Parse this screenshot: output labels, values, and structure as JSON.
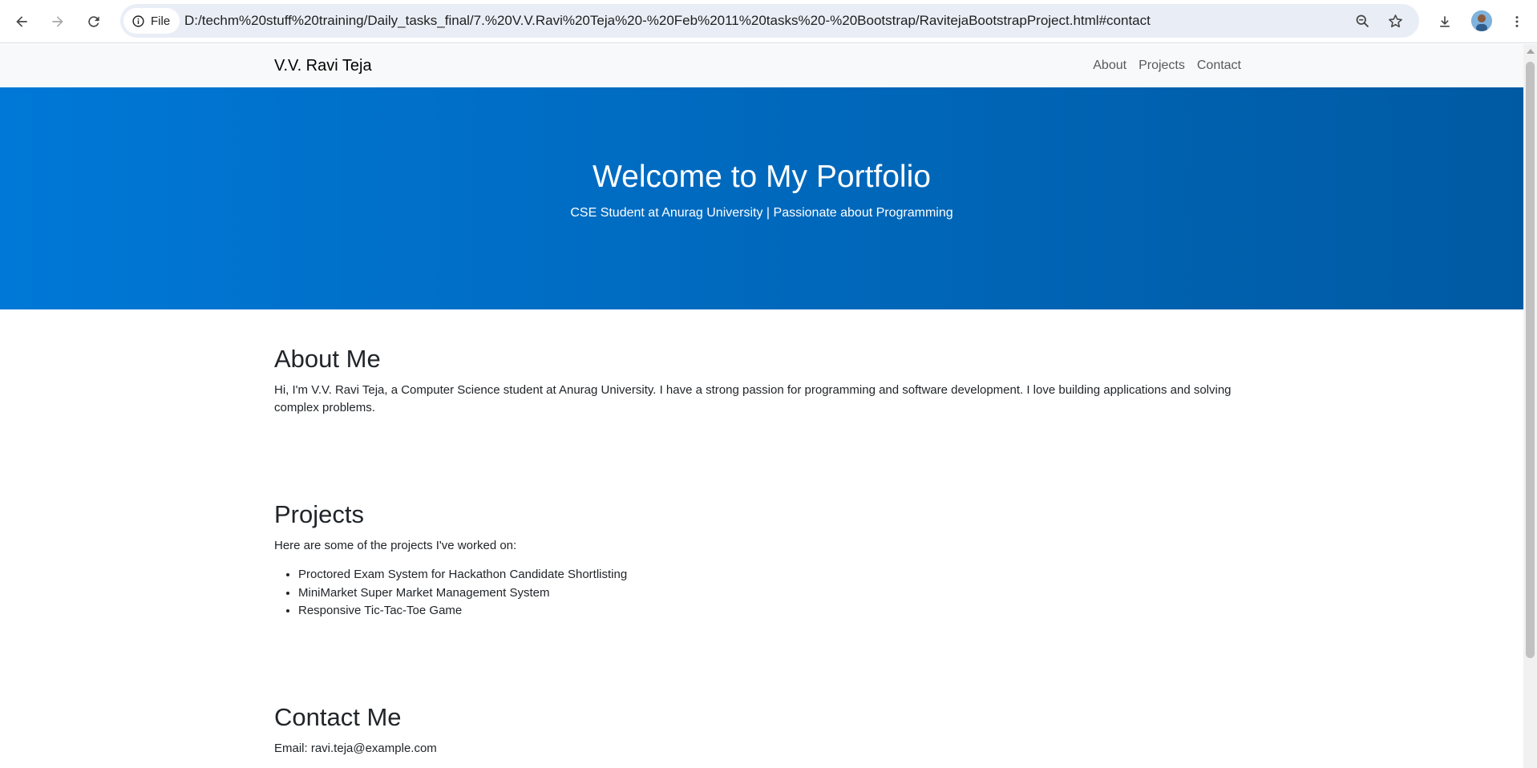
{
  "browser": {
    "site_chip_label": "File",
    "url": "D:/techm%20stuff%20training/Daily_tasks_final/7.%20V.V.Ravi%20Teja%20-%20Feb%2011%20tasks%20-%20Bootstrap/RavitejaBootstrapProject.html#contact",
    "icons": [
      "back-icon",
      "forward-icon",
      "reload-icon",
      "info-icon",
      "zoom-icon",
      "star-icon",
      "download-icon",
      "avatar",
      "more-icon"
    ]
  },
  "navbar": {
    "brand": "V.V. Ravi Teja",
    "links": [
      "About",
      "Projects",
      "Contact"
    ]
  },
  "hero": {
    "title": "Welcome to My Portfolio",
    "subtitle": "CSE Student at Anurag University | Passionate about Programming",
    "gradient_start": "#0078d7",
    "gradient_end": "#005aa3"
  },
  "about": {
    "heading": "About Me",
    "text": "Hi, I'm V.V. Ravi Teja, a Computer Science student at Anurag University. I have a strong passion for programming and software development. I love building applications and solving complex problems."
  },
  "projects": {
    "heading": "Projects",
    "intro": "Here are some of the projects I've worked on:",
    "items": [
      "Proctored Exam System for Hackathon Candidate Shortlisting",
      "MiniMarket Super Market Management System",
      "Responsive Tic-Tac-Toe Game"
    ]
  },
  "contact": {
    "heading": "Contact Me",
    "email_line": "Email: ravi.teja@example.com"
  }
}
